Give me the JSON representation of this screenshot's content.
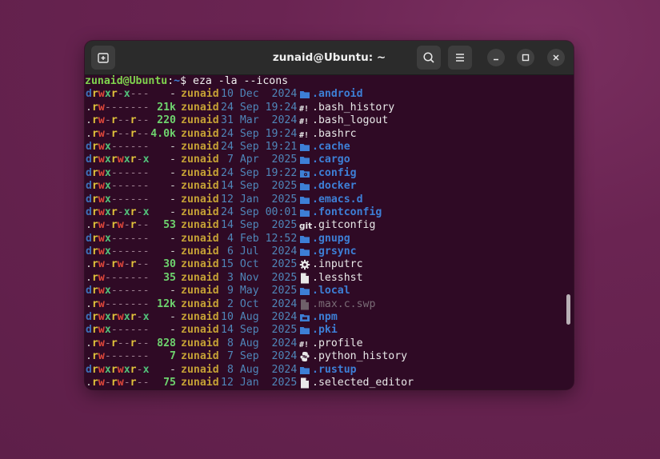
{
  "window": {
    "title": "zunaid@Ubuntu: ~",
    "buttons": {
      "new_tab": "new-tab",
      "search": "search",
      "menu": "menu",
      "minimize": "minimize",
      "maximize": "maximize",
      "close": "close"
    }
  },
  "prompt": {
    "user_host": "zunaid@Ubuntu",
    "sep": ":",
    "path": "~",
    "symbol": "$ ",
    "command": "eza -la --icons"
  },
  "colors": {
    "dir": "#3d7fd6",
    "user": "#c5a135",
    "date": "#4f86b8",
    "size": "#6ed36e",
    "bg": "#2f0a25"
  },
  "entries": [
    {
      "perms": "drwxr-x---",
      "size": "-",
      "user": "zunaid",
      "date": "10 Dec  2024",
      "icon": "folder-icon",
      "name": ".android",
      "kind": "dir"
    },
    {
      "perms": ".rw-------",
      "size": "21k",
      "user": "zunaid",
      "date": "24 Sep 19:24",
      "icon": "shebang-icon",
      "name": ".bash_history",
      "kind": "file"
    },
    {
      "perms": ".rw-r--r--",
      "size": "220",
      "user": "zunaid",
      "date": "31 Mar  2024",
      "icon": "shebang-icon",
      "name": ".bash_logout",
      "kind": "file"
    },
    {
      "perms": ".rw-r--r--",
      "size": "4.0k",
      "user": "zunaid",
      "date": "24 Sep 19:24",
      "icon": "shebang-icon",
      "name": ".bashrc",
      "kind": "file"
    },
    {
      "perms": "drwx------",
      "size": "-",
      "user": "zunaid",
      "date": "24 Sep 19:21",
      "icon": "folder-icon",
      "name": ".cache",
      "kind": "dir"
    },
    {
      "perms": "drwxrwxr-x",
      "size": "-",
      "user": "zunaid",
      "date": " 7 Apr  2025",
      "icon": "folder-icon",
      "name": ".cargo",
      "kind": "dir"
    },
    {
      "perms": "drwx------",
      "size": "-",
      "user": "zunaid",
      "date": "24 Sep 19:22",
      "icon": "folder-gear-icon",
      "name": ".config",
      "kind": "dir"
    },
    {
      "perms": "drwx------",
      "size": "-",
      "user": "zunaid",
      "date": "14 Sep  2025",
      "icon": "folder-icon",
      "name": ".docker",
      "kind": "dir"
    },
    {
      "perms": "drwx------",
      "size": "-",
      "user": "zunaid",
      "date": "12 Jan  2025",
      "icon": "folder-icon",
      "name": ".emacs.d",
      "kind": "dir"
    },
    {
      "perms": "drwxr-xr-x",
      "size": "-",
      "user": "zunaid",
      "date": "24 Sep 00:01",
      "icon": "folder-icon",
      "name": ".fontconfig",
      "kind": "dir"
    },
    {
      "perms": ".rw-rw-r--",
      "size": "53",
      "user": "zunaid",
      "date": "14 Sep  2025",
      "icon": "git-icon",
      "name": ".gitconfig",
      "kind": "file"
    },
    {
      "perms": "drwx------",
      "size": "-",
      "user": "zunaid",
      "date": " 4 Feb 12:52",
      "icon": "folder-icon",
      "name": ".gnupg",
      "kind": "dir"
    },
    {
      "perms": "drwx------",
      "size": "-",
      "user": "zunaid",
      "date": " 6 Jul  2024",
      "icon": "folder-icon",
      "name": ".grsync",
      "kind": "dir"
    },
    {
      "perms": ".rw-rw-r--",
      "size": "30",
      "user": "zunaid",
      "date": "15 Oct  2025",
      "icon": "gear-icon",
      "name": ".inputrc",
      "kind": "file"
    },
    {
      "perms": ".rw-------",
      "size": "35",
      "user": "zunaid",
      "date": " 3 Nov  2025",
      "icon": "file-icon",
      "name": ".lesshst",
      "kind": "file"
    },
    {
      "perms": "drwx------",
      "size": "-",
      "user": "zunaid",
      "date": " 9 May  2025",
      "icon": "folder-icon",
      "name": ".local",
      "kind": "dir"
    },
    {
      "perms": ".rw-------",
      "size": "12k",
      "user": "zunaid",
      "date": " 2 Oct  2024",
      "icon": "file-dim-icon",
      "name": ".max.c.swp",
      "kind": "dim"
    },
    {
      "perms": "drwxrwxr-x",
      "size": "-",
      "user": "zunaid",
      "date": "10 Aug  2024",
      "icon": "folder-npm-icon",
      "name": ".npm",
      "kind": "dir"
    },
    {
      "perms": "drwx------",
      "size": "-",
      "user": "zunaid",
      "date": "14 Sep  2025",
      "icon": "folder-icon",
      "name": ".pki",
      "kind": "dir"
    },
    {
      "perms": ".rw-r--r--",
      "size": "828",
      "user": "zunaid",
      "date": " 8 Aug  2024",
      "icon": "shebang-icon",
      "name": ".profile",
      "kind": "file"
    },
    {
      "perms": ".rw-------",
      "size": "7",
      "user": "zunaid",
      "date": " 7 Sep  2024",
      "icon": "python-icon",
      "name": ".python_history",
      "kind": "file"
    },
    {
      "perms": "drwxrwxr-x",
      "size": "-",
      "user": "zunaid",
      "date": " 8 Aug  2024",
      "icon": "folder-icon",
      "name": ".rustup",
      "kind": "dir"
    },
    {
      "perms": ".rw-rw-r--",
      "size": "75",
      "user": "zunaid",
      "date": "12 Jan  2025",
      "icon": "file-icon",
      "name": ".selected_editor",
      "kind": "file"
    }
  ]
}
